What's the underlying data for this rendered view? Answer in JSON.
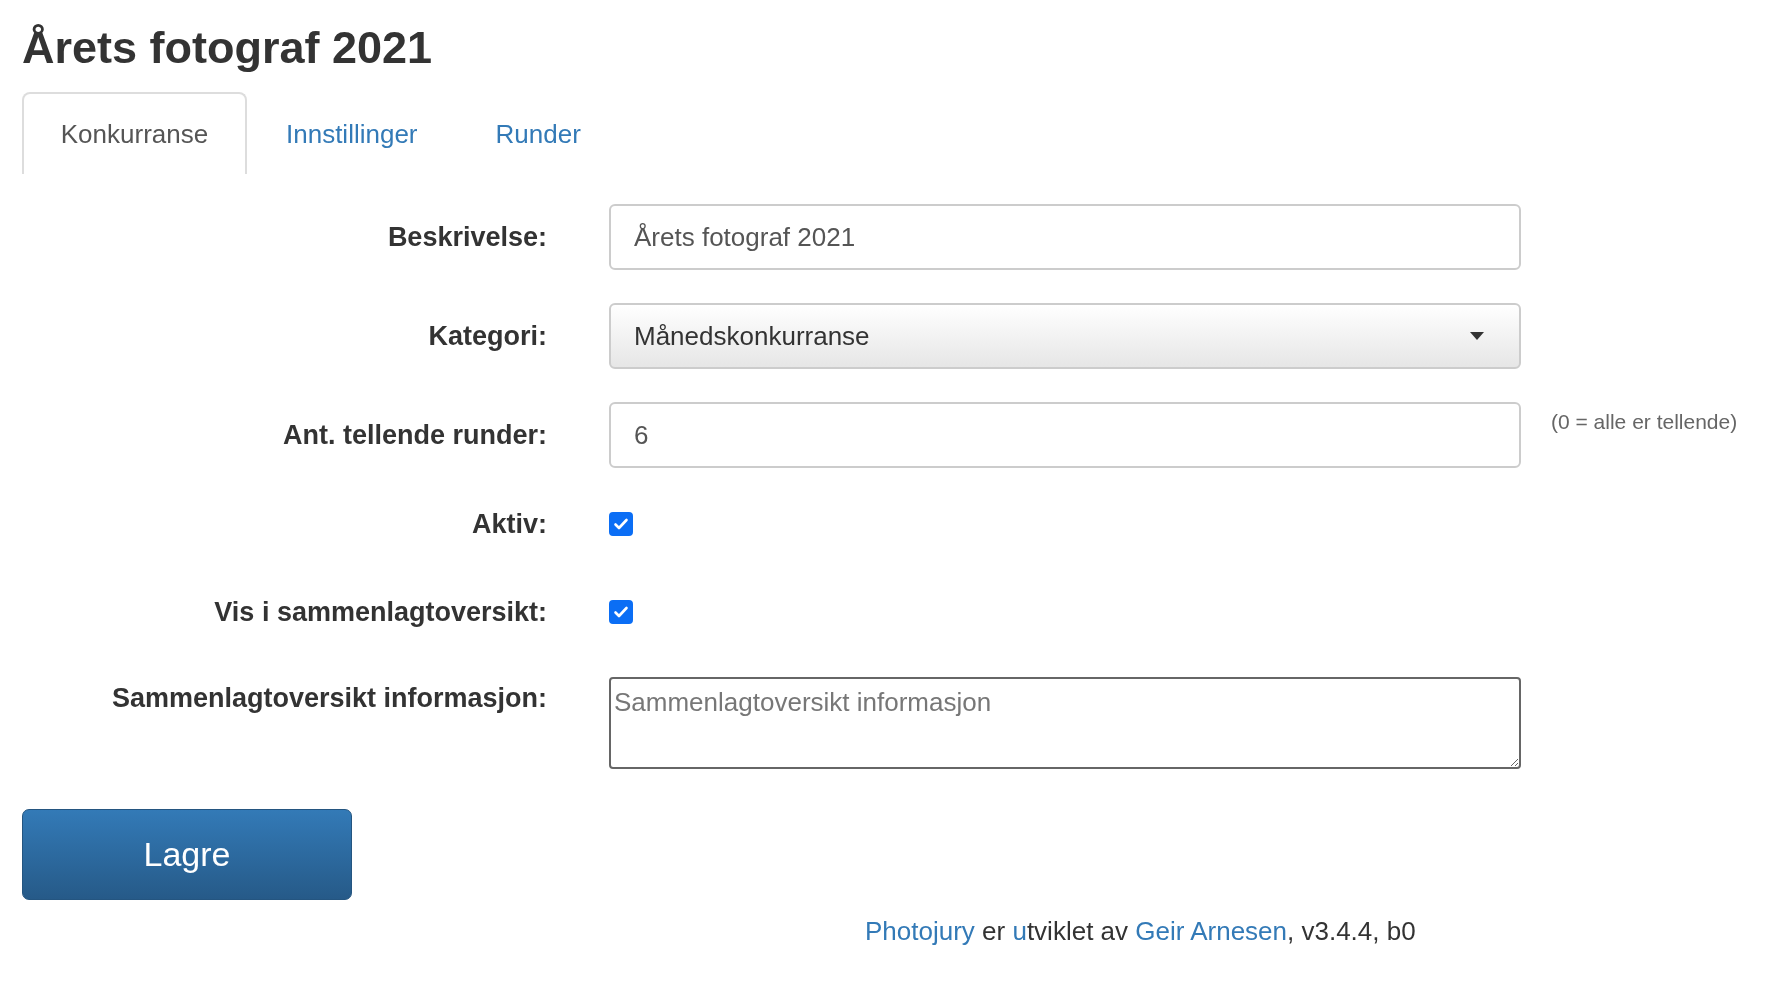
{
  "title": "Årets fotograf 2021",
  "tabs": [
    {
      "label": "Konkurranse",
      "selected": true
    },
    {
      "label": "Innstillinger",
      "selected": false
    },
    {
      "label": "Runder",
      "selected": false
    }
  ],
  "fields": [
    {
      "kind": "text",
      "label": "Beskrivelse:",
      "value": "Årets fotograf 2021"
    },
    {
      "kind": "select",
      "label": "Kategori:",
      "value": "Månedskonkurranse"
    },
    {
      "kind": "text",
      "label": "Ant. tellende runder:",
      "value": "6",
      "hint": "(0 = alle er tellende)"
    },
    {
      "kind": "checkbox",
      "label": "Aktiv:",
      "checked": true
    },
    {
      "kind": "checkbox",
      "label": "Vis i sammenlagtoversikt:",
      "checked": true
    },
    {
      "kind": "textarea",
      "label": "Sammenlagtoversikt informasjon:",
      "placeholder": "Sammenlagtoversikt informasjon"
    }
  ],
  "save_button": "Lagre",
  "footer": [
    {
      "kind": "link",
      "text": "Photojury"
    },
    {
      "kind": "text",
      "text": " er "
    },
    {
      "kind": "link",
      "text": "u"
    },
    {
      "kind": "text",
      "text": "tviklet av "
    },
    {
      "kind": "link",
      "text": "Geir Arnesen"
    },
    {
      "kind": "text",
      "text": ", v3.4.4, b0"
    }
  ]
}
